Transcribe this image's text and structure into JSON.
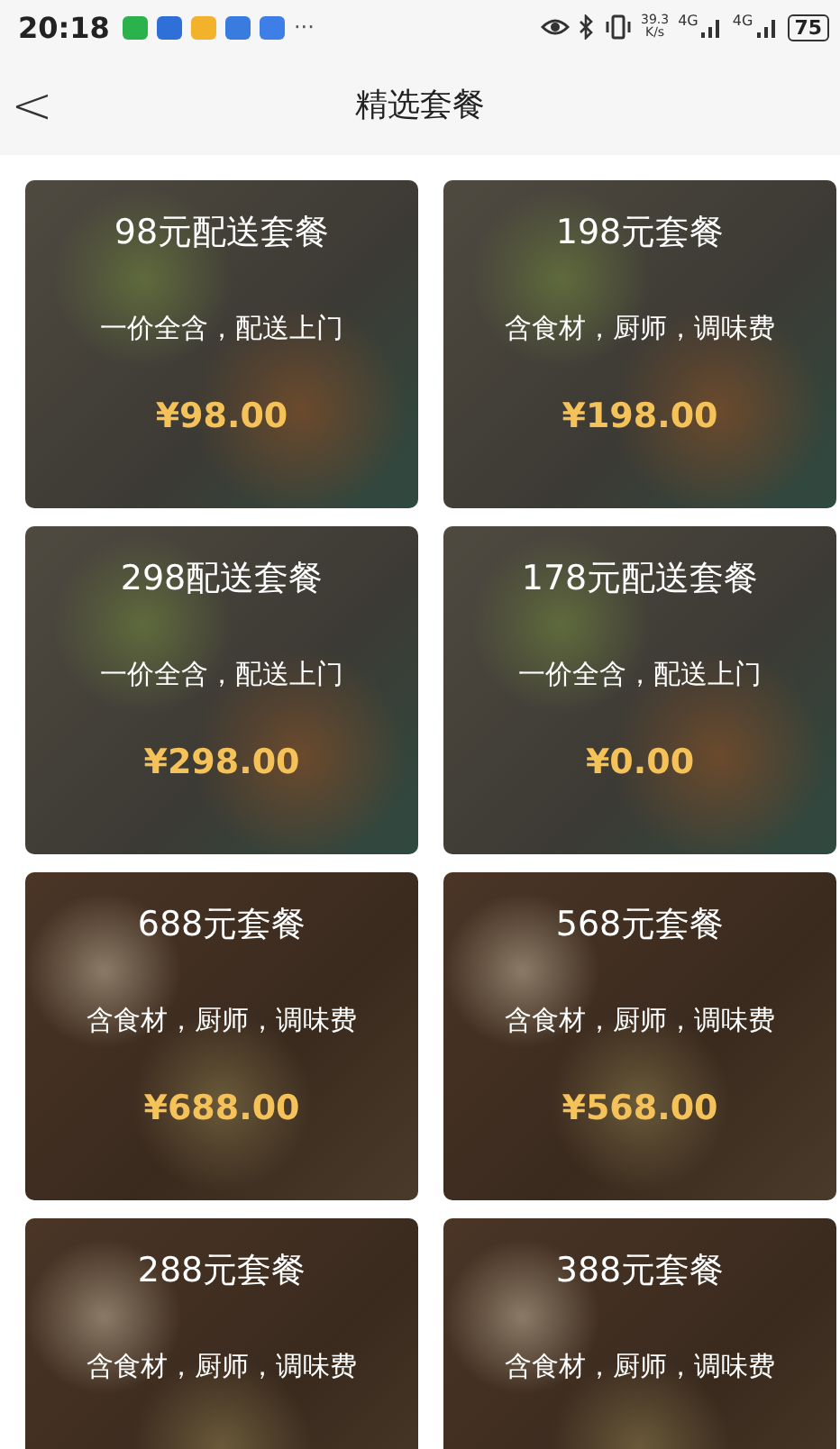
{
  "status_bar": {
    "time": "20:18",
    "notifications": [
      {
        "color": "#2bb24c"
      },
      {
        "color": "#2f6fd8"
      },
      {
        "color": "#f3b22c"
      },
      {
        "color": "#3a7be0"
      },
      {
        "color": "#3d7fe6"
      }
    ],
    "more": "···",
    "speed": "39.3",
    "speed_unit": "K/s",
    "network_1": "4G",
    "network_2": "4G",
    "battery": "75"
  },
  "header": {
    "back": "<",
    "title": "精选套餐"
  },
  "packages": [
    {
      "title": "98元配送套餐",
      "subtitle": "一价全含，配送上门",
      "price": "¥98.00",
      "kind": "dishes"
    },
    {
      "title": "198元套餐",
      "subtitle": "含食材，厨师，调味费",
      "price": "¥198.00",
      "kind": "dishes"
    },
    {
      "title": "298配送套餐",
      "subtitle": "一价全含，配送上门",
      "price": "¥298.00",
      "kind": "dishes"
    },
    {
      "title": "178元配送套餐",
      "subtitle": "一价全含，配送上门",
      "price": "¥0.00",
      "kind": "dishes"
    },
    {
      "title": "688元套餐",
      "subtitle": "含食材，厨师，调味费",
      "price": "¥688.00",
      "kind": "table"
    },
    {
      "title": "568元套餐",
      "subtitle": "含食材，厨师，调味费",
      "price": "¥568.00",
      "kind": "table"
    },
    {
      "title": "288元套餐",
      "subtitle": "含食材，厨师，调味费",
      "kind": "table"
    },
    {
      "title": "388元套餐",
      "subtitle": "含食材，厨师，调味费",
      "kind": "table"
    }
  ]
}
